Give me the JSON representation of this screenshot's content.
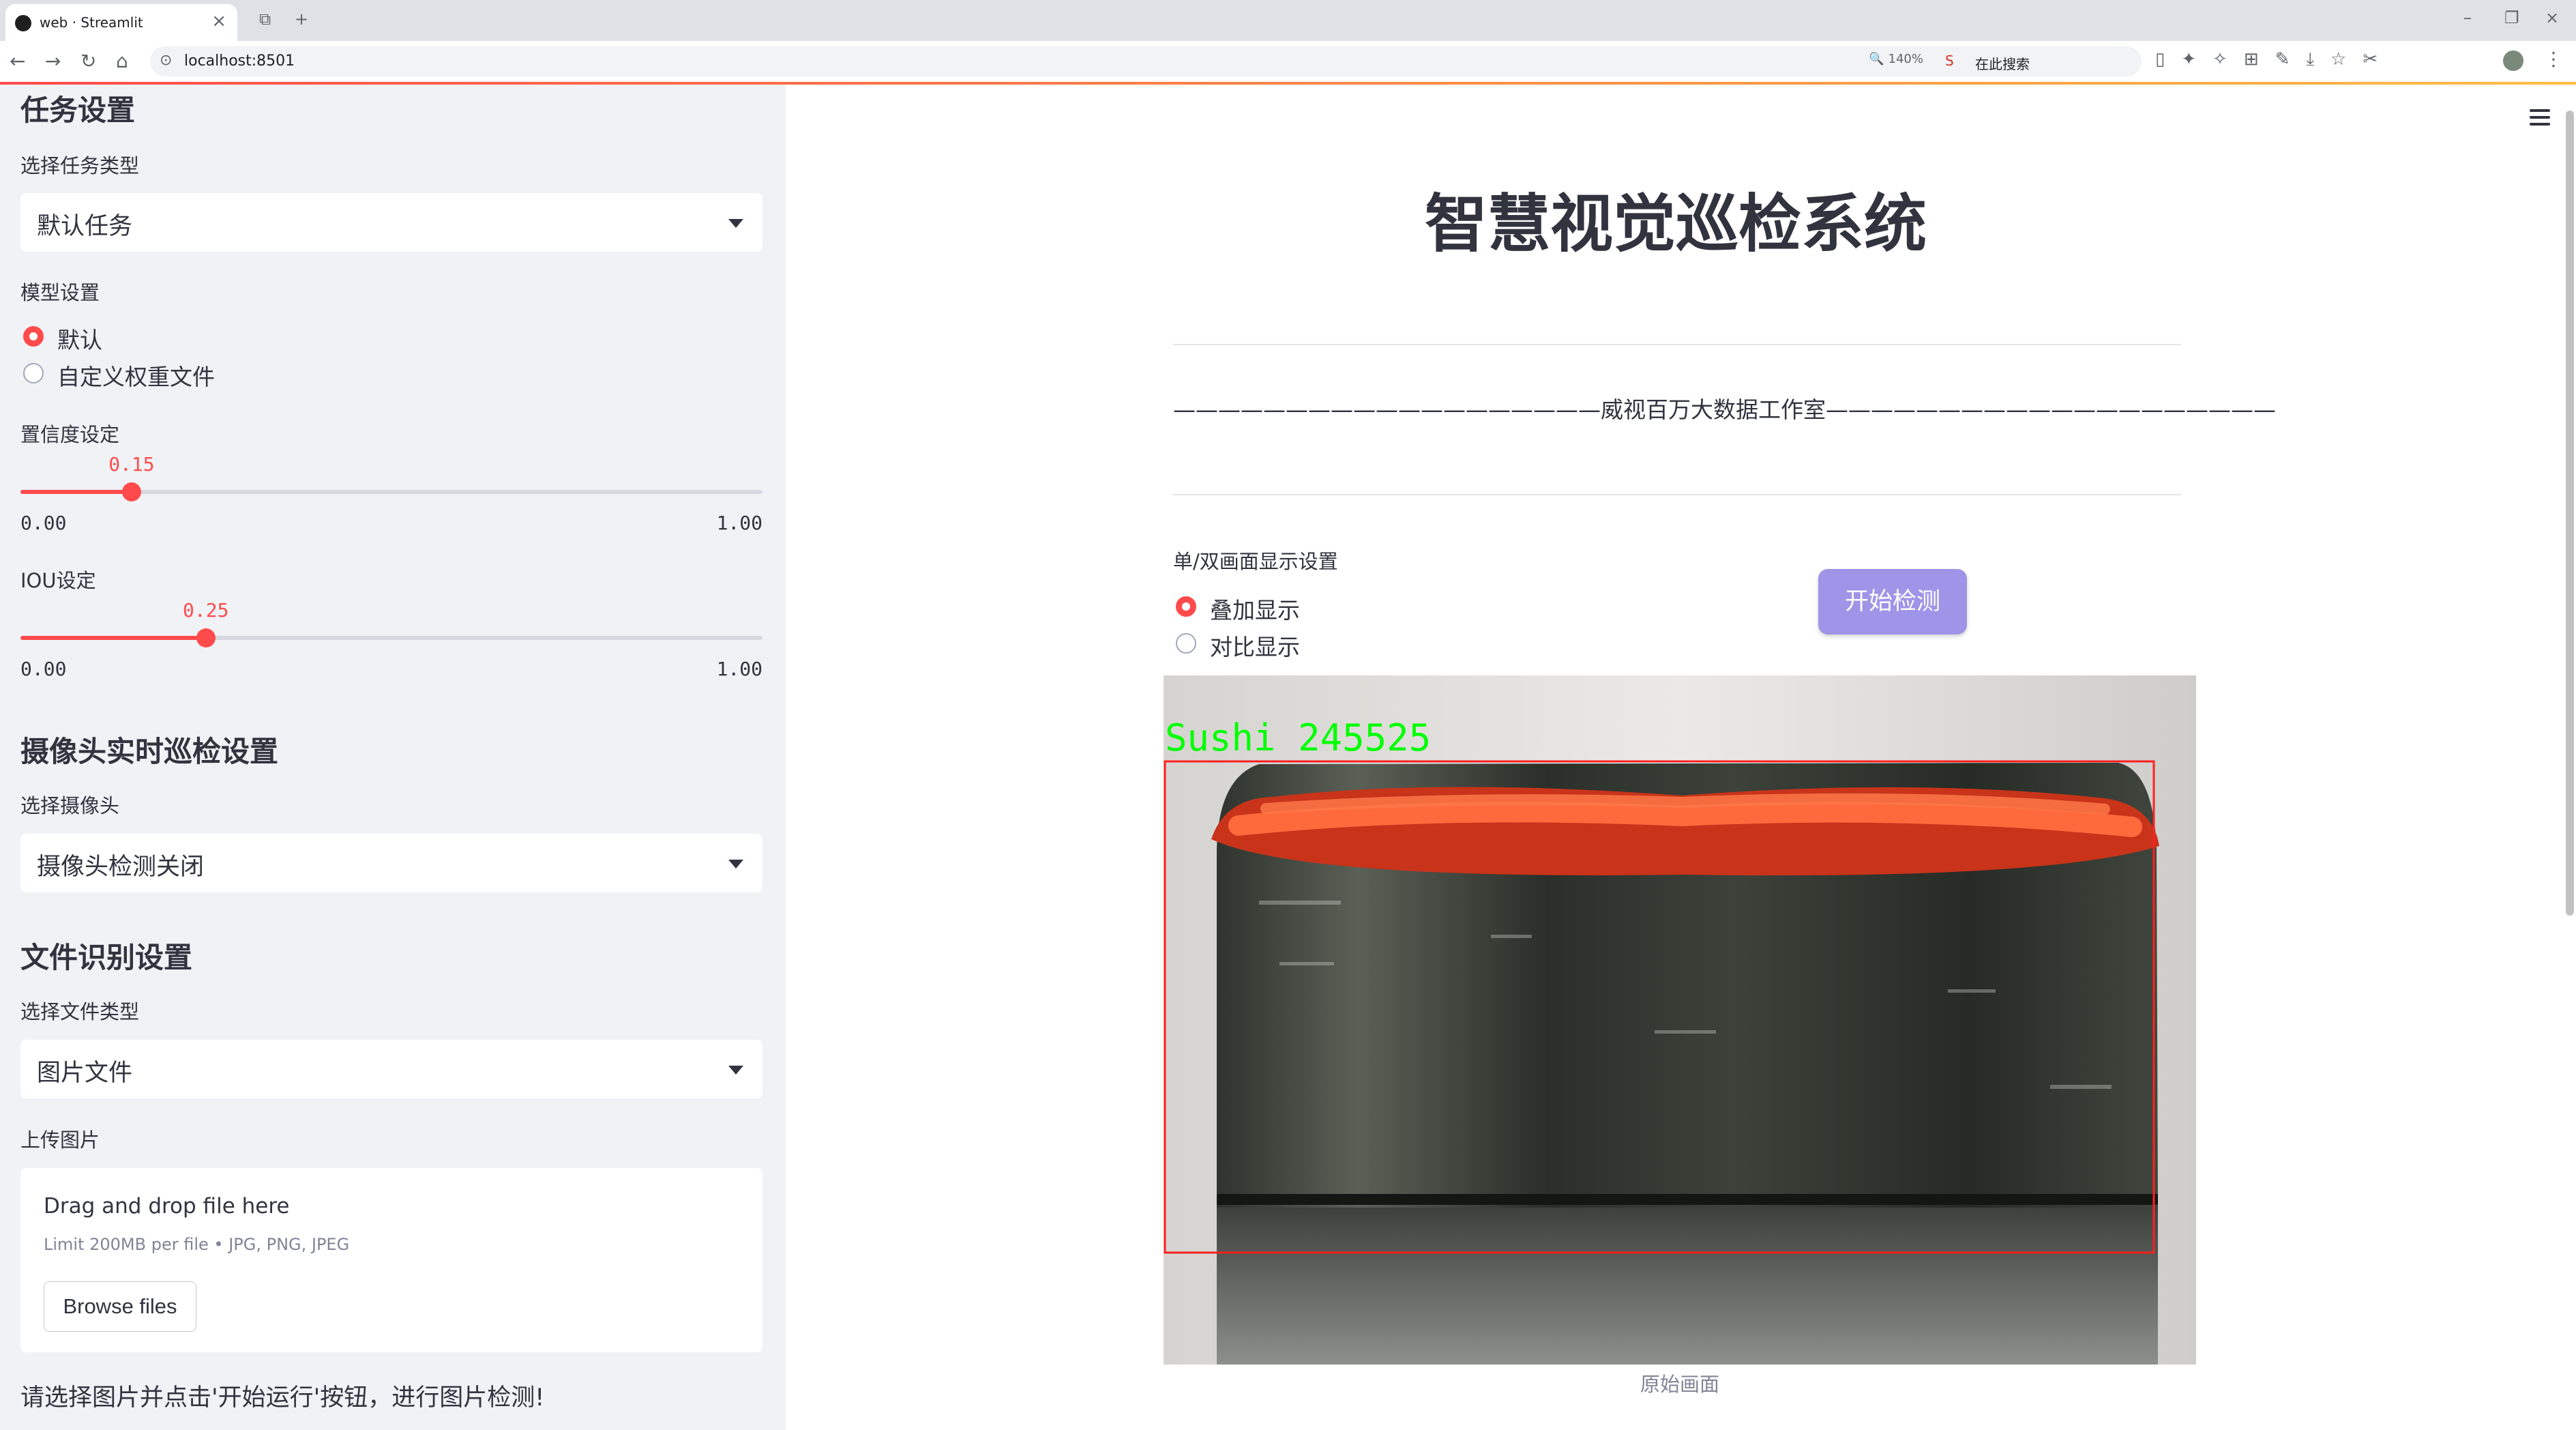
{
  "browser": {
    "tab_title": "web · Streamlit",
    "url": "localhost:8501",
    "zoom": "140%",
    "search_placeholder": "在此搜索",
    "search_engine_glyph": "S",
    "icons": [
      "back-icon",
      "forward-icon",
      "reload-icon",
      "home-icon",
      "zoom-icon",
      "translate-icon",
      "bolt-icon",
      "screenshot-icon",
      "share-icon",
      "star-icon",
      "menu-dots-icon"
    ]
  },
  "sidebar": {
    "task_heading": "任务设置",
    "task_type_label": "选择任务类型",
    "task_type_value": "默认任务",
    "model_label": "模型设置",
    "model_options": [
      "默认",
      "自定义权重文件"
    ],
    "model_selected": 0,
    "confidence": {
      "label": "置信度设定",
      "value": 0.15,
      "value_text": "0.15",
      "min": "0.00",
      "max": "1.00"
    },
    "iou": {
      "label": "IOU设定",
      "value": 0.25,
      "value_text": "0.25",
      "min": "0.00",
      "max": "1.00"
    },
    "camera_heading": "摄像头实时巡检设置",
    "camera_label": "选择摄像头",
    "camera_value": "摄像头检测关闭",
    "file_heading": "文件识别设置",
    "file_type_label": "选择文件类型",
    "file_type_value": "图片文件",
    "upload_label": "上传图片",
    "upload_title": "Drag and drop file here",
    "upload_limit": "Limit 200MB per file • JPG, PNG, JPEG",
    "browse_label": "Browse files",
    "note": "请选择图片并点击'开始运行'按钮，进行图片检测!"
  },
  "main": {
    "title": "智慧视觉巡检系统",
    "studio_line": "———————————————————威视百万大数据工作室————————————————————",
    "mode_label": "单/双画面显示设置",
    "mode_options": [
      "叠加显示",
      "对比显示"
    ],
    "mode_selected": 0,
    "start_button": "开始检测",
    "detection_label": "Sushi 245525",
    "caption": "原始画面"
  },
  "colors": {
    "accent": "#ff4b4b",
    "button": "#9e95e8",
    "detection_box": "#ff2020",
    "detection_text": "#00ff00"
  }
}
